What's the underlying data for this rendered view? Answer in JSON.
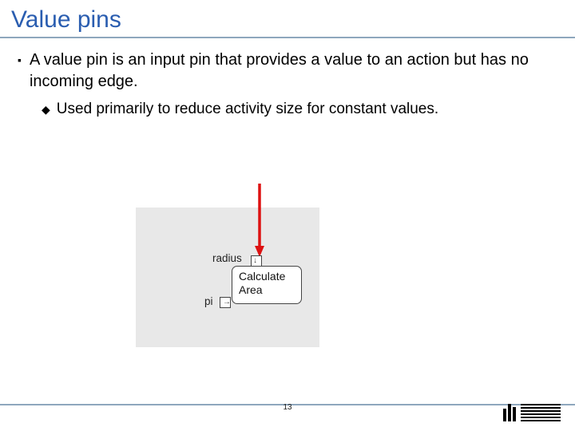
{
  "title": "Value pins",
  "bullets": {
    "level1": "A value pin is an input pin that provides a value to an action but has no incoming edge.",
    "level2": "Used primarily to reduce activity size for constant values."
  },
  "diagram": {
    "radius_label": "radius",
    "pi_label": "pi",
    "action_label": "Calculate Area"
  },
  "page_number": "13",
  "colors": {
    "title": "#2a5db0",
    "rule": "#8ea7bd",
    "arrow": "#d11"
  },
  "logo_name": "IBM"
}
